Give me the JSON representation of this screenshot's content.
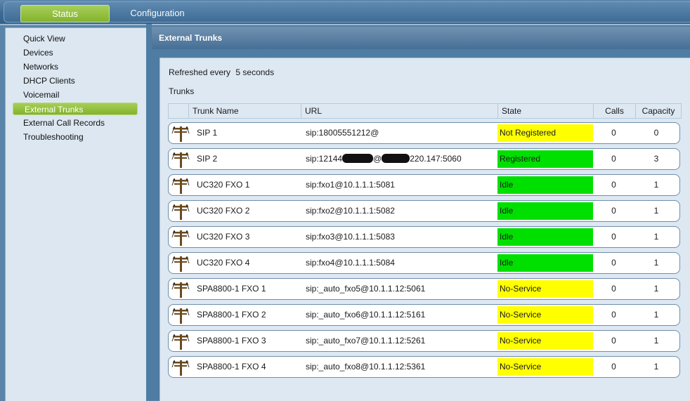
{
  "tabs": {
    "status": "Status",
    "configuration": "Configuration"
  },
  "sidebar": {
    "items": [
      {
        "label": "Quick View"
      },
      {
        "label": "Devices"
      },
      {
        "label": "Networks"
      },
      {
        "label": "DHCP Clients"
      },
      {
        "label": "Voicemail"
      },
      {
        "label": "External Trunks"
      },
      {
        "label": "External Call Records"
      },
      {
        "label": "Troubleshooting"
      }
    ],
    "active": "External Trunks"
  },
  "page": {
    "title": "External Trunks",
    "refresh_prefix": "Refreshed every",
    "refresh_value": "5 seconds",
    "trunks_label": "Trunks"
  },
  "table": {
    "headers": {
      "name": "Trunk Name",
      "url": "URL",
      "state": "State",
      "calls": "Calls",
      "capacity": "Capacity"
    },
    "rows": [
      {
        "name": "SIP 1",
        "url": "sip:18005551212@",
        "state": "Not Registered",
        "state_color": "#ffff00",
        "calls": "0",
        "capacity": "0"
      },
      {
        "name": "SIP 2",
        "url_parts": [
          "sip:12144",
          "@",
          "220.147:5060"
        ],
        "state": "Registered",
        "state_color": "#00e000",
        "calls": "0",
        "capacity": "3"
      },
      {
        "name": "UC320 FXO 1",
        "url": "sip:fxo1@10.1.1.1:5081",
        "state": "Idle",
        "state_color": "#00e000",
        "calls": "0",
        "capacity": "1"
      },
      {
        "name": "UC320 FXO 2",
        "url": "sip:fxo2@10.1.1.1:5082",
        "state": "Idle",
        "state_color": "#00e000",
        "calls": "0",
        "capacity": "1"
      },
      {
        "name": "UC320 FXO 3",
        "url": "sip:fxo3@10.1.1.1:5083",
        "state": "Idle",
        "state_color": "#00e000",
        "calls": "0",
        "capacity": "1"
      },
      {
        "name": "UC320 FXO 4",
        "url": "sip:fxo4@10.1.1.1:5084",
        "state": "Idle",
        "state_color": "#00e000",
        "calls": "0",
        "capacity": "1"
      },
      {
        "name": "SPA8800-1 FXO 1",
        "url": "sip:_auto_fxo5@10.1.1.12:5061",
        "state": "No-Service",
        "state_color": "#ffff00",
        "calls": "0",
        "capacity": "1"
      },
      {
        "name": "SPA8800-1 FXO 2",
        "url": "sip:_auto_fxo6@10.1.1.12:5161",
        "state": "No-Service",
        "state_color": "#ffff00",
        "calls": "0",
        "capacity": "1"
      },
      {
        "name": "SPA8800-1 FXO 3",
        "url": "sip:_auto_fxo7@10.1.1.12:5261",
        "state": "No-Service",
        "state_color": "#ffff00",
        "calls": "0",
        "capacity": "1"
      },
      {
        "name": "SPA8800-1 FXO 4",
        "url": "sip:_auto_fxo8@10.1.1.12:5361",
        "state": "No-Service",
        "state_color": "#ffff00",
        "calls": "0",
        "capacity": "1"
      }
    ]
  },
  "icons": {
    "trunk": "telephone-pole-icon"
  }
}
